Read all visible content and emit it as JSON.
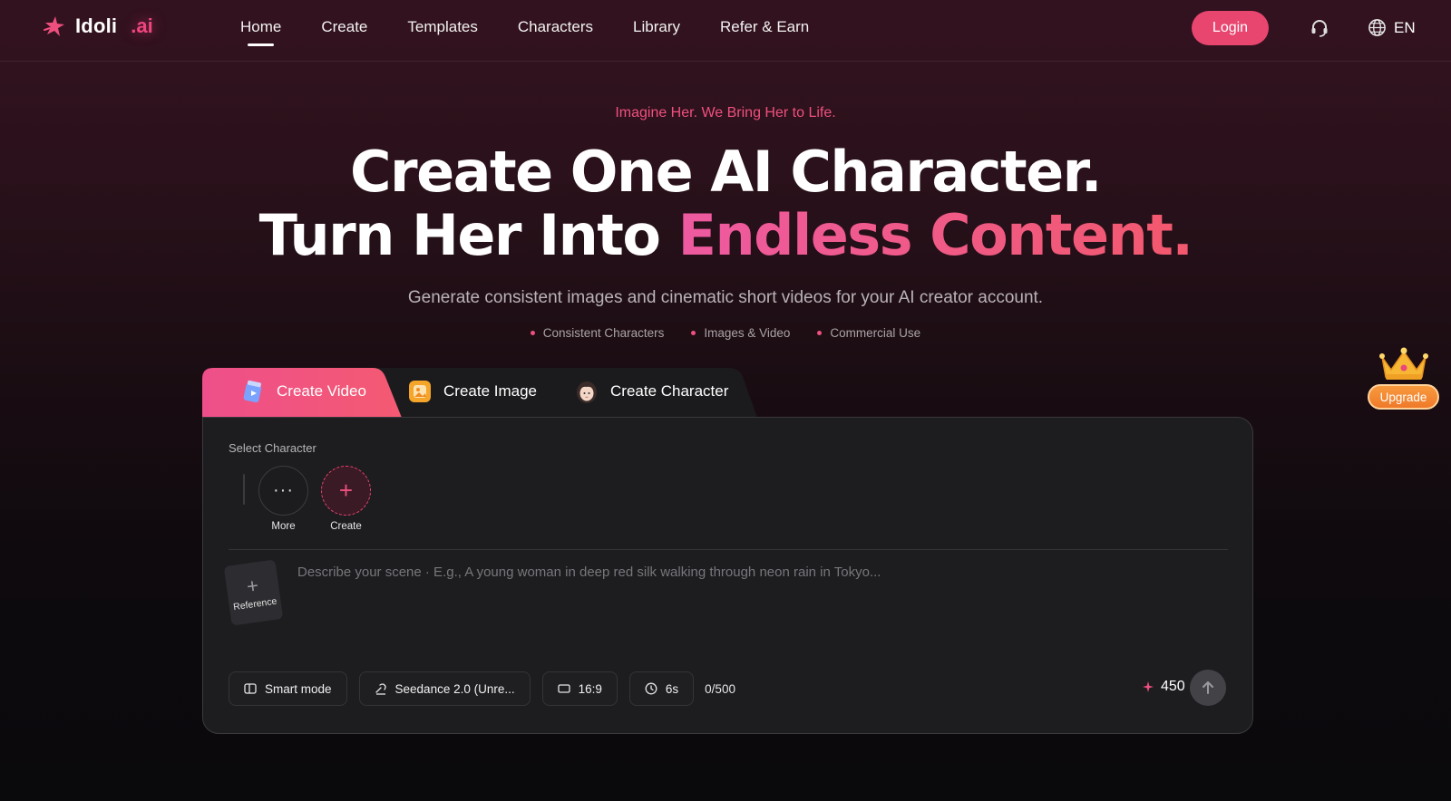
{
  "brand": {
    "name": "Idoli",
    "suffix": ".ai"
  },
  "nav": {
    "links": [
      "Home",
      "Create",
      "Templates",
      "Characters",
      "Library",
      "Refer & Earn"
    ],
    "active": "Home",
    "login_label": "Login",
    "language": "EN"
  },
  "hero": {
    "eyebrow": "Imagine Her. We Bring Her to Life.",
    "line1": "Create One AI Character.",
    "line2_plain": "Turn Her Into ",
    "line2_accent": "Endless Content.",
    "subtitle": "Generate consistent images and cinematic short videos for your AI creator account.",
    "bullets": [
      "Consistent Characters",
      "Images & Video",
      "Commercial Use"
    ]
  },
  "tabs": [
    {
      "label": "Create Video",
      "icon": "video-icon",
      "active": true
    },
    {
      "label": "Create Image",
      "icon": "image-icon",
      "active": false
    },
    {
      "label": "Create Character",
      "icon": "character-avatar-icon",
      "active": false
    }
  ],
  "panel": {
    "select_character_label": "Select Character",
    "more_label": "More",
    "create_label": "Create",
    "reference_label": "Reference",
    "prompt_placeholder": "Describe your scene · E.g., A young woman in deep red silk walking through neon rain in Tokyo...",
    "smart_mode_label": "Smart mode",
    "model_label": "Seedance 2.0 (Unre...",
    "aspect_label": "16:9",
    "duration_label": "6s",
    "char_count": "0/500",
    "credits": "450"
  },
  "upgrade": {
    "label": "Upgrade"
  },
  "colors": {
    "accent": "#e8456f",
    "accent_gradient_start": "#ee5aa0",
    "accent_gradient_end": "#f2596d",
    "upgrade": "#f08a35"
  }
}
